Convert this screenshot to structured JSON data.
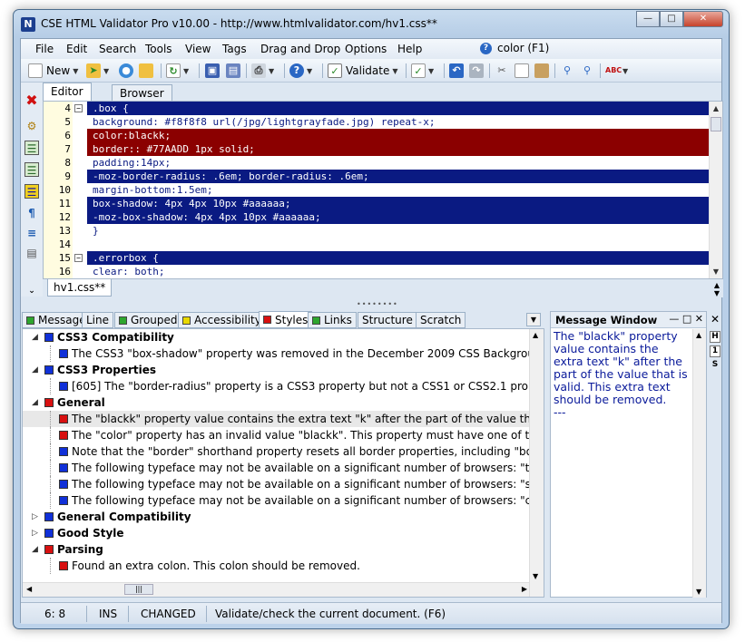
{
  "window": {
    "title": "CSE HTML Validator Pro v10.00 - http://www.htmlvalidator.com/hv1.css**",
    "app_icon": "N"
  },
  "menu": [
    "File",
    "Edit",
    "Search",
    "Tools",
    "View",
    "Tags",
    "Drag and Drop",
    "Options",
    "Help"
  ],
  "help_search": "color (F1)",
  "toolbar": {
    "new_label": "New",
    "validate_label": "Validate"
  },
  "editor_tabs": [
    "Editor",
    "Browser"
  ],
  "code_lines": [
    {
      "n": "4",
      "text": ".box {",
      "style": "sel",
      "fold": "−"
    },
    {
      "n": "5",
      "text": "background: #f8f8f8 url(/jpg/lightgrayfade.jpg) repeat-x;",
      "style": "norm"
    },
    {
      "n": "6",
      "text": "color:blackk;",
      "style": "err"
    },
    {
      "n": "7",
      "text": "border:: #77AADD 1px solid;",
      "style": "err"
    },
    {
      "n": "8",
      "text": "padding:14px;",
      "style": "norm"
    },
    {
      "n": "9",
      "text": "-moz-border-radius: .6em; border-radius: .6em;",
      "style": "sel"
    },
    {
      "n": "10",
      "text": "margin-bottom:1.5em;",
      "style": "norm"
    },
    {
      "n": "11",
      "text": "box-shadow: 4px 4px 10px #aaaaaa;",
      "style": "sel"
    },
    {
      "n": "12",
      "text": "-moz-box-shadow: 4px 4px 10px #aaaaaa;",
      "style": "sel"
    },
    {
      "n": "13",
      "text": "}",
      "style": "norm"
    },
    {
      "n": "14",
      "text": "",
      "style": "norm"
    },
    {
      "n": "15",
      "text": ".errorbox {",
      "style": "sel",
      "fold": "−"
    },
    {
      "n": "16",
      "text": "clear: both;",
      "style": "norm"
    }
  ],
  "file_tab": "hv1.css**",
  "bottom_tabs": [
    {
      "label": "Message",
      "color": "#2ea62e"
    },
    {
      "label": "Line",
      "color": ""
    },
    {
      "label": "Grouped",
      "color": "#2ea62e"
    },
    {
      "label": "Accessibility",
      "color": "#e8d800"
    },
    {
      "label": "Styles",
      "color": "#d81010"
    },
    {
      "label": "Links",
      "color": "#2ea62e"
    },
    {
      "label": "Structure",
      "color": ""
    },
    {
      "label": "Scratch",
      "color": ""
    }
  ],
  "messages": [
    {
      "level": 0,
      "text": "CSS3 Compatibility",
      "color": "#1030d8",
      "bold": true,
      "tri": "◢"
    },
    {
      "level": 1,
      "text": "The CSS3 \"box-shadow\" property was removed in the December 2009 CSS Backgroun...",
      "color": "#1030d8"
    },
    {
      "level": 0,
      "text": "CSS3 Properties",
      "color": "#1030d8",
      "bold": true,
      "tri": "◢"
    },
    {
      "level": 1,
      "text": "[605] The \"border-radius\" property is a CSS3 property but not a CSS1 or CSS2.1 prop...",
      "color": "#1030d8"
    },
    {
      "level": 0,
      "text": "General",
      "color": "#d81010",
      "bold": true,
      "tri": "◢"
    },
    {
      "level": 1,
      "text": "The \"blackk\" property value contains the extra text \"k\" after the part of the value that i...",
      "color": "#d81010",
      "active": true
    },
    {
      "level": 1,
      "text": "The \"color\" property has an invalid value \"blackk\". This property must have one of the f...",
      "color": "#d81010"
    },
    {
      "level": 1,
      "text": "Note that the \"border\" shorthand property resets all border properties, including \"borde...",
      "color": "#1030d8"
    },
    {
      "level": 1,
      "text": "The following typeface may not be available on a significant number of browsers: \"taho...",
      "color": "#1030d8"
    },
    {
      "level": 1,
      "text": "The following typeface may not be available on a significant number of browsers: \"sego...",
      "color": "#1030d8"
    },
    {
      "level": 1,
      "text": "The following typeface may not be available on a significant number of browsers: \"cons...",
      "color": "#1030d8"
    },
    {
      "level": 0,
      "text": "General Compatibility",
      "color": "#1030d8",
      "bold": true,
      "tri": "▷"
    },
    {
      "level": 0,
      "text": "Good Style",
      "color": "#1030d8",
      "bold": true,
      "tri": "▷"
    },
    {
      "level": 0,
      "text": "Parsing",
      "color": "#d81010",
      "bold": true,
      "tri": "◢"
    },
    {
      "level": 1,
      "text": "Found an extra colon. This colon should be removed.",
      "color": "#d81010"
    }
  ],
  "message_window": {
    "title": "Message Window",
    "text": "The \"blackk\" property value contains the extra text \"k\" after the part of the value that is valid. This extra text should be removed.",
    "footer": "---"
  },
  "side_right_icons": [
    "H",
    "1",
    "S"
  ],
  "status": {
    "position": "6: 8",
    "mode": "INS",
    "state": "CHANGED",
    "hint": "Validate/check the current document. (F6)"
  }
}
